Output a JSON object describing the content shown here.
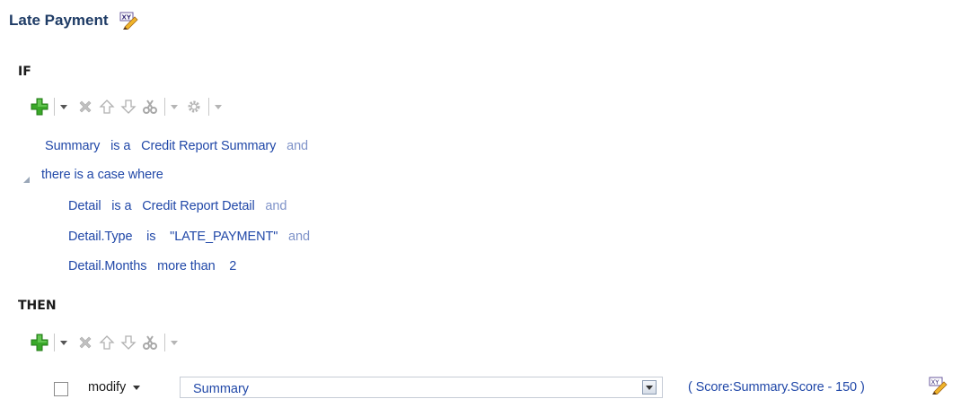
{
  "rule": {
    "title": "Late Payment",
    "title_icon": "edit-expression-icon"
  },
  "if_section": {
    "label": "IF",
    "toolbar": [
      "add-icon",
      "dropdown-caret-icon",
      "delete-icon",
      "move-up-icon",
      "move-down-icon",
      "cut-icon",
      "dropdown-caret-icon",
      "gear-icon",
      "dropdown-caret-icon"
    ],
    "line1": {
      "var": "Summary",
      "op": "is a",
      "value": "Credit Report Summary",
      "conj": "and"
    },
    "case": {
      "label": "there is a case where"
    },
    "line2": {
      "var": "Detail",
      "op": "is a",
      "value": "Credit Report Detail",
      "conj": "and"
    },
    "line3": {
      "var": "Detail.Type",
      "op": "is",
      "value": "\"LATE_PAYMENT\"",
      "conj": "and"
    },
    "line4": {
      "var": "Detail.Months",
      "op": "more than",
      "value": "2"
    }
  },
  "then_section": {
    "label": "THEN",
    "toolbar": [
      "add-icon",
      "dropdown-caret-icon",
      "delete-icon",
      "move-up-icon",
      "move-down-icon",
      "cut-icon",
      "dropdown-caret-icon"
    ],
    "action": {
      "checked": false,
      "verb": "modify",
      "target": "Summary",
      "expression": "( Score:Summary.Score - 150 )"
    }
  },
  "colors": {
    "link_blue": "#2148a8",
    "conj_blue": "#7f93c9",
    "title": "#1f3c66",
    "add_green": "#3aa829"
  }
}
